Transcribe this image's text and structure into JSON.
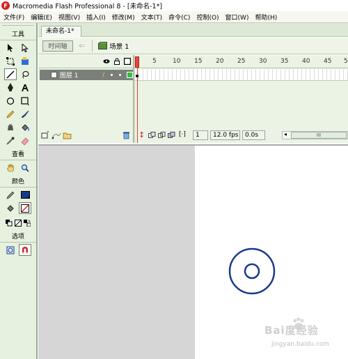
{
  "window": {
    "title": "Macromedia Flash Professional 8 - [未命名-1*]",
    "logo": "F"
  },
  "menu": [
    "文件(F)",
    "编辑(E)",
    "视图(V)",
    "插入(I)",
    "修改(M)",
    "文本(T)",
    "命令(C)",
    "控制(O)",
    "窗口(W)",
    "帮助(H)"
  ],
  "toolbox": {
    "tools_label": "工具",
    "view_label": "查看",
    "colors_label": "颜色",
    "options_label": "选项",
    "stroke_color": "#1a1a1a",
    "fill_color": "#1b3a8c"
  },
  "document": {
    "tab": "未命名-1*"
  },
  "editbar": {
    "timeline_button": "时间轴",
    "scene": "场景 1"
  },
  "timeline": {
    "layer_name": "图层 1",
    "frame_numbers": [
      "1",
      "5",
      "10",
      "15",
      "20",
      "25",
      "30",
      "35",
      "40",
      "45",
      "5"
    ],
    "current_frame": "1",
    "fps": "12.0 fps",
    "elapsed": "0.0s",
    "scroll_grip": "III"
  },
  "stage": {
    "shape": "ring",
    "stroke_color": "#1b3a8c",
    "background": "#ffffff"
  },
  "watermark": {
    "text": "Bai度经验",
    "sub": "jingyan.baidu.com"
  }
}
